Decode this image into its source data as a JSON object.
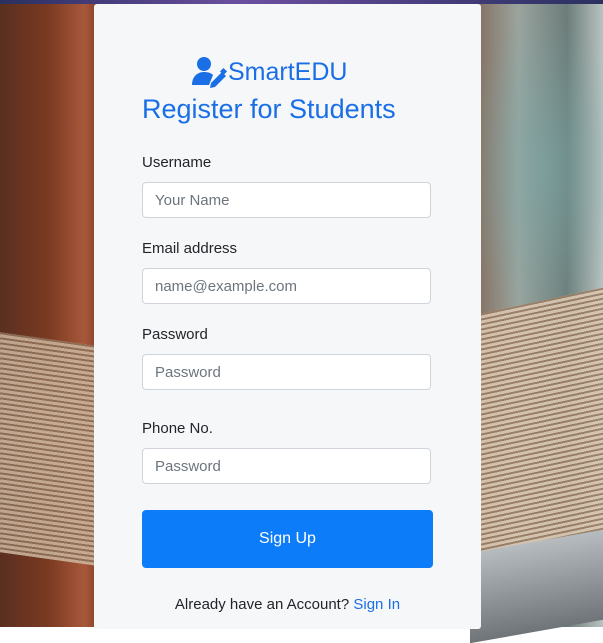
{
  "brand": {
    "name": "SmartEDU",
    "icon": "user-edit-icon"
  },
  "title": "Register for Students",
  "form": {
    "username": {
      "label": "Username",
      "placeholder": "Your Name"
    },
    "email": {
      "label": "Email address",
      "placeholder": "name@example.com"
    },
    "password": {
      "label": "Password",
      "placeholder": "Password"
    },
    "phone": {
      "label": "Phone No.",
      "placeholder": "Password"
    },
    "submit_label": "Sign Up"
  },
  "footer": {
    "text": "Already have an Account?",
    "link_label": "Sign In"
  },
  "colors": {
    "accent": "#1a6ee6",
    "button": "#0d7cf8",
    "card": "#f6f7f9"
  }
}
